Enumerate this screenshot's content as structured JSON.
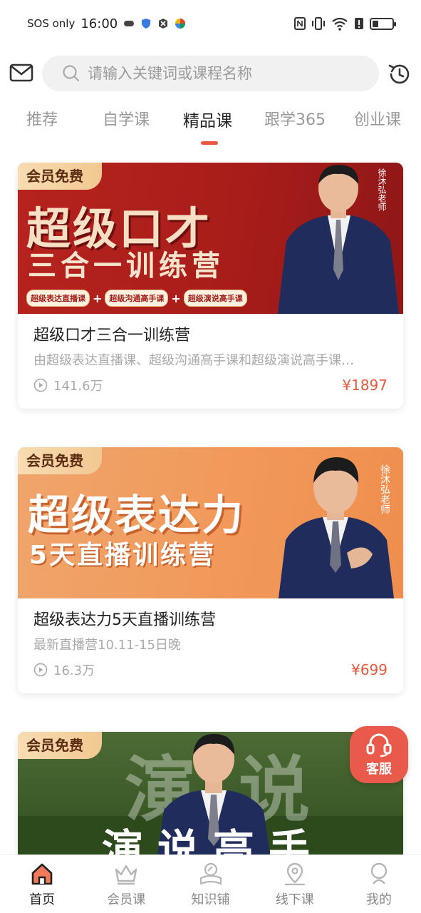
{
  "status_bar": {
    "carrier": "SOS only",
    "time": "16:00"
  },
  "search": {
    "placeholder": "请输入关键词或课程名称"
  },
  "tabs": [
    {
      "label": "推荐"
    },
    {
      "label": "自学课"
    },
    {
      "label": "精品课"
    },
    {
      "label": "跟学365"
    },
    {
      "label": "创业课"
    }
  ],
  "courses": [
    {
      "badge": "会员免费",
      "banner_title_1": "超级口才",
      "banner_title_2": "三合一训练营",
      "banner_teacher": "徐沐弘老师",
      "banner_chips": [
        "超级表达直播课",
        "超级沟通高手课",
        "超级演说高手课"
      ],
      "title": "超级口才三合一训练营",
      "desc": "由超级表达直播课、超级沟通高手课和超级演说高手课…",
      "views": "141.6万",
      "price": "¥1897"
    },
    {
      "badge": "会员免费",
      "banner_title_1": "超级表达力",
      "banner_title_2": "5天直播训练营",
      "banner_teacher": "徐沐弘老师",
      "title": "超级表达力5天直播训练营",
      "desc": "最新直播营10.11-15日晚",
      "views": "16.3万",
      "price": "¥699"
    },
    {
      "badge": "会员免费",
      "banner_title_1": "演说",
      "banner_title_2": "演说高手"
    }
  ],
  "service": {
    "label": "客服"
  },
  "bottom_nav": [
    {
      "label": "首页",
      "icon": "home-icon"
    },
    {
      "label": "会员课",
      "icon": "crown-icon"
    },
    {
      "label": "知识铺",
      "icon": "book-icon"
    },
    {
      "label": "线下课",
      "icon": "map-pin-icon"
    },
    {
      "label": "我的",
      "icon": "profile-icon"
    }
  ],
  "colors": {
    "accent": "#e8573d",
    "price": "#e55a3e",
    "service": "#ea5a4a"
  }
}
